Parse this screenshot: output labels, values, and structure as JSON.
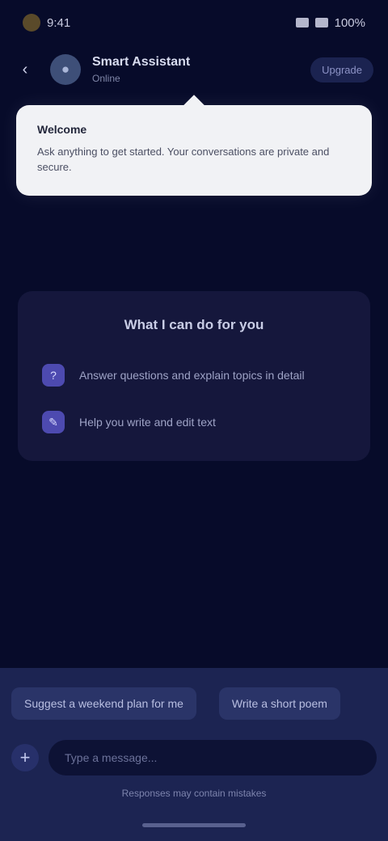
{
  "status_bar": {
    "time": "9:41",
    "battery": "100%"
  },
  "header": {
    "title": "Smart Assistant",
    "subtitle": "Online",
    "action_label": "Upgrade"
  },
  "notice": {
    "title": "Welcome",
    "body": "Ask anything to get started. Your conversations are private and secure."
  },
  "feature_card": {
    "title": "What I can do for you",
    "items": [
      {
        "label": "Answer questions and explain topics in detail"
      },
      {
        "label": "Help you write and edit text"
      }
    ]
  },
  "quick_replies": [
    {
      "label": "Suggest a weekend plan for me"
    },
    {
      "label": "Write a short poem"
    }
  ],
  "composer": {
    "placeholder": "Type a message..."
  },
  "footer": {
    "note": "Responses may contain mistakes"
  },
  "colors": {
    "background": "#070b2a",
    "accent": "#4d4ab0",
    "panel": "#1c2452"
  }
}
